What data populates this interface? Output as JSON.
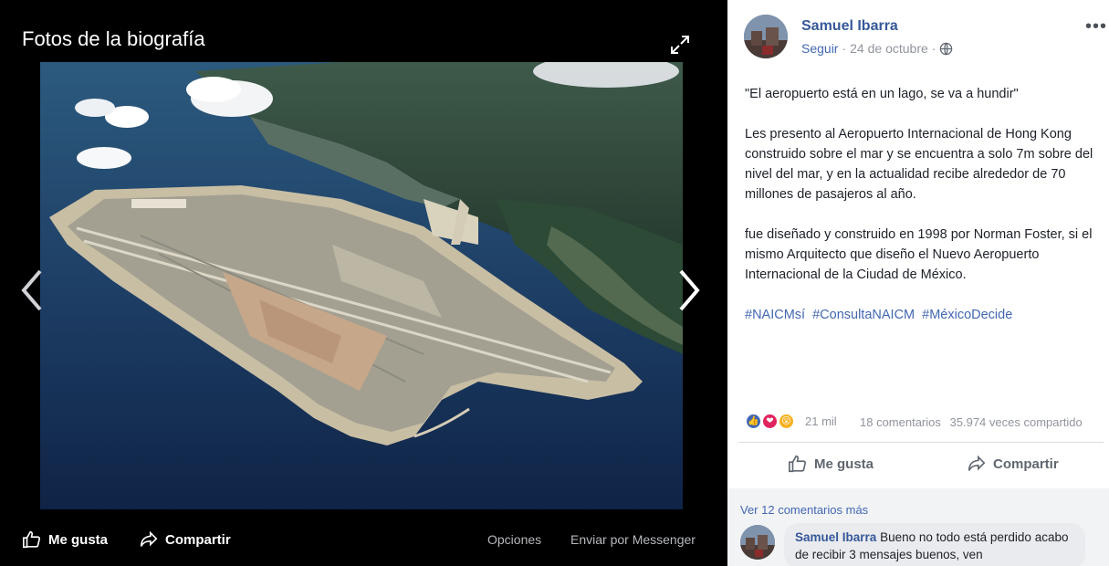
{
  "viewer": {
    "title": "Fotos de la biografía",
    "icons": {
      "expand": "expand-icon",
      "prev": "chevron-left-icon",
      "next": "chevron-right-icon",
      "like": "thumbs-up-icon",
      "share": "share-arrow-icon"
    },
    "like_label": "Me gusta",
    "share_label": "Compartir",
    "options_label": "Opciones",
    "messenger_label": "Enviar por Messenger"
  },
  "post": {
    "author": "Samuel Ibarra",
    "follow_label": "Seguir",
    "separator": "·",
    "date": "24 de octubre",
    "separator2": "·",
    "privacy_icon": "globe-icon",
    "more_icon": "•••",
    "paragraphs": [
      "\"El aeropuerto está en un lago, se va a hundir\"",
      "Les presento al Aeropuerto Internacional de Hong Kong construido sobre el mar y se encuentra a solo 7m sobre del nivel del mar, y en la actualidad recibe alrededor de 70 millones de pasajeros al año.",
      "fue diseñado y construido en 1998 por Norman Foster, si el mismo Arquitecto que diseño el Nuevo Aeropuerto Internacional de la Ciudad de México."
    ],
    "hashtags": [
      "#NAICMsí",
      "#ConsultaNAICM",
      "#MéxicoDecide"
    ],
    "reactions": {
      "icons": [
        "like-reaction-icon",
        "love-reaction-icon",
        "wow-reaction-icon"
      ],
      "count": "21 mil"
    },
    "comments_count": "18 comentarios",
    "shares_count": "35.974 veces compartido",
    "like_label": "Me gusta",
    "share_label": "Compartir"
  },
  "comments": {
    "more_label": "Ver 12 comentarios más",
    "items": [
      {
        "author": "Samuel Ibarra",
        "text": "Bueno no todo está perdido acabo de recibir 3 mensajes buenos, ven"
      }
    ]
  },
  "colors": {
    "link": "#365899",
    "accent": "#4267b2",
    "muted": "#90949c",
    "viewer_bg": "#000000",
    "comments_bg": "#f2f3f5"
  }
}
